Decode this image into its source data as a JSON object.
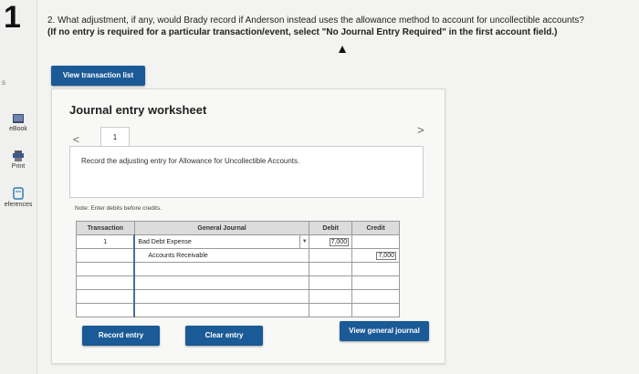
{
  "step_number": "1",
  "rail": {
    "mark": "s",
    "items": [
      {
        "label": "eBook",
        "icon": "book-icon"
      },
      {
        "label": "Print",
        "icon": "printer-icon"
      },
      {
        "label": "eferences",
        "icon": "references-icon"
      }
    ]
  },
  "question": {
    "text": "2. What adjustment, if any, would Brady record if Anderson instead uses the allowance method to account for uncollectible accounts?",
    "instruction": "(If no entry is required for a particular transaction/event, select \"No Journal Entry Required\" in the first account field.)"
  },
  "buttons": {
    "view_transaction_list": "View transaction list",
    "record_entry": "Record entry",
    "clear_entry": "Clear entry",
    "view_general_journal": "View general journal"
  },
  "worksheet": {
    "title": "Journal entry worksheet",
    "prev": "<",
    "next": ">",
    "tab_label": "1",
    "instruction": "Record the adjusting entry for Allowance for Uncollectible Accounts.",
    "note": "Note: Enter debits before credits."
  },
  "table": {
    "headers": {
      "transaction": "Transaction",
      "general_journal": "General Journal",
      "debit": "Debit",
      "credit": "Credit"
    },
    "rows": [
      {
        "transaction": "1",
        "account": "Bad Debt Expense",
        "debit": "7,000",
        "credit": ""
      },
      {
        "transaction": "",
        "account": "Accounts Receivable",
        "debit": "",
        "credit": "7,000"
      },
      {
        "transaction": "",
        "account": "",
        "debit": "",
        "credit": ""
      },
      {
        "transaction": "",
        "account": "",
        "debit": "",
        "credit": ""
      },
      {
        "transaction": "",
        "account": "",
        "debit": "",
        "credit": ""
      },
      {
        "transaction": "",
        "account": "",
        "debit": "",
        "credit": ""
      }
    ]
  },
  "colors": {
    "button_blue": "#1a5a96",
    "header_gray": "#dcdcdc"
  }
}
